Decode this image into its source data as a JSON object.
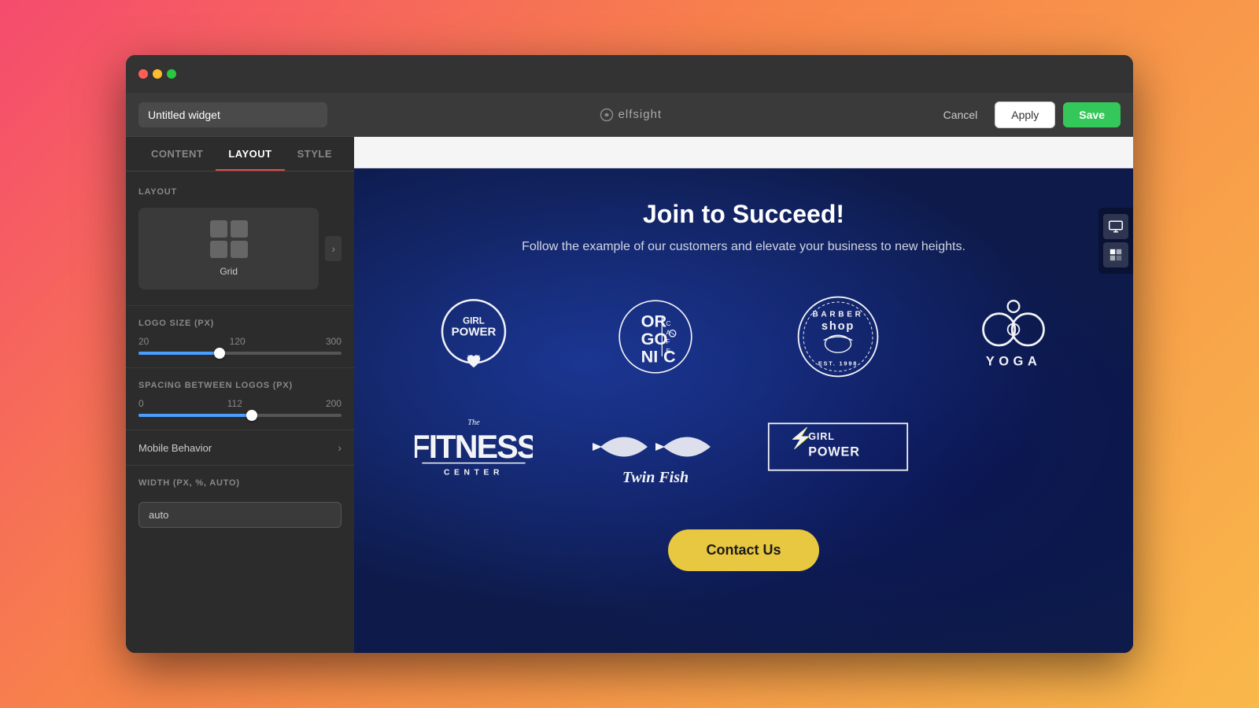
{
  "window": {
    "traffic_lights": [
      "red",
      "yellow",
      "green"
    ]
  },
  "header": {
    "widget_name": "Untitled widget",
    "widget_name_placeholder": "Untitled widget",
    "logo_text": "elfsight",
    "cancel_label": "Cancel",
    "apply_label": "Apply",
    "save_label": "Save"
  },
  "tabs": [
    {
      "id": "content",
      "label": "CONTENT",
      "active": false
    },
    {
      "id": "layout",
      "label": "LAYOUT",
      "active": true
    },
    {
      "id": "style",
      "label": "STYLE",
      "active": false
    }
  ],
  "sidebar": {
    "layout_label": "LAYOUT",
    "layout_options": [
      {
        "id": "grid",
        "label": "Grid",
        "active": true
      }
    ],
    "logo_size_label": "LOGO SIZE (PX)",
    "logo_size_min": "20",
    "logo_size_value": "120",
    "logo_size_max": "300",
    "logo_size_slider_pct": 40,
    "spacing_label": "SPACING BETWEEN LOGOS (PX)",
    "spacing_min": "0",
    "spacing_value": "112",
    "spacing_max": "200",
    "spacing_slider_pct": 56,
    "mobile_behavior_label": "Mobile Behavior",
    "width_label": "WIDTH (PX, %, AUTO)",
    "width_value": "auto"
  },
  "preview": {
    "title": "Join to Succeed!",
    "subtitle": "Follow the example of our customers and elevate your business to new heights.",
    "cta_label": "Contact Us",
    "logos": [
      {
        "id": "girl-power",
        "alt": "Girl Power"
      },
      {
        "id": "organic-cafe",
        "alt": "Organic Cafe"
      },
      {
        "id": "barber-shop",
        "alt": "Barber Shop"
      },
      {
        "id": "yoga",
        "alt": "Yoga"
      },
      {
        "id": "fitness-center",
        "alt": "The Fitness Center"
      },
      {
        "id": "twin-fish",
        "alt": "Twin Fish"
      },
      {
        "id": "girl-power-2",
        "alt": "Girl Power 2"
      }
    ]
  }
}
